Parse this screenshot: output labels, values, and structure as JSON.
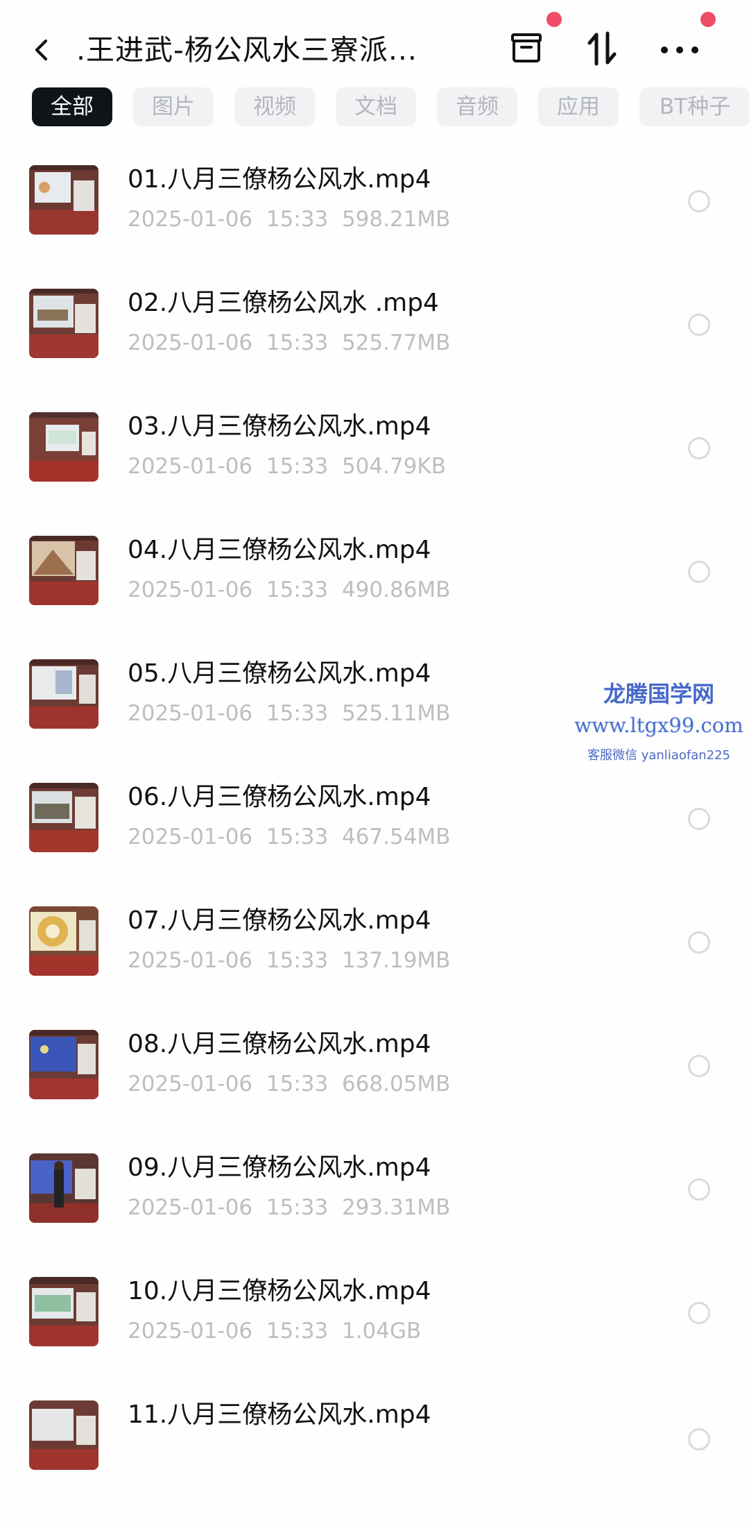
{
  "header": {
    "title": ".王进武-杨公风水三寮派...",
    "back_icon": "chevron-left-icon",
    "archive_icon": "archive-box-icon",
    "sort_icon": "sort-arrows-icon",
    "more_icon": "more-dots-icon",
    "badge_color": "#ee4c67"
  },
  "tabs": [
    {
      "label": "全部",
      "active": true
    },
    {
      "label": "图片",
      "active": false
    },
    {
      "label": "视频",
      "active": false
    },
    {
      "label": "文档",
      "active": false
    },
    {
      "label": "音频",
      "active": false
    },
    {
      "label": "应用",
      "active": false
    },
    {
      "label": "BT种子",
      "active": false
    }
  ],
  "files": [
    {
      "name": "01.八月三僚杨公风水.mp4",
      "date": "2025-01-06",
      "time": "15:33",
      "size": "598.21MB"
    },
    {
      "name": "02.八月三僚杨公风水 .mp4",
      "date": "2025-01-06",
      "time": "15:33",
      "size": "525.77MB"
    },
    {
      "name": "03.八月三僚杨公风水.mp4",
      "date": "2025-01-06",
      "time": "15:33",
      "size": "504.79KB"
    },
    {
      "name": "04.八月三僚杨公风水.mp4",
      "date": "2025-01-06",
      "time": "15:33",
      "size": "490.86MB"
    },
    {
      "name": "05.八月三僚杨公风水.mp4",
      "date": "2025-01-06",
      "time": "15:33",
      "size": "525.11MB"
    },
    {
      "name": "06.八月三僚杨公风水.mp4",
      "date": "2025-01-06",
      "time": "15:33",
      "size": "467.54MB"
    },
    {
      "name": "07.八月三僚杨公风水.mp4",
      "date": "2025-01-06",
      "time": "15:33",
      "size": "137.19MB"
    },
    {
      "name": "08.八月三僚杨公风水.mp4",
      "date": "2025-01-06",
      "time": "15:33",
      "size": "668.05MB"
    },
    {
      "name": "09.八月三僚杨公风水.mp4",
      "date": "2025-01-06",
      "time": "15:33",
      "size": "293.31MB"
    },
    {
      "name": "10.八月三僚杨公风水.mp4",
      "date": "2025-01-06",
      "time": "15:33",
      "size": "1.04GB"
    },
    {
      "name": "11.八月三僚杨公风水.mp4",
      "date": "",
      "time": "",
      "size": ""
    }
  ],
  "watermark": {
    "site_name": "龙腾国学网",
    "url": "www.ltgx99.com",
    "contact": "客服微信 yanliaofan225",
    "color": "#4668c9"
  }
}
